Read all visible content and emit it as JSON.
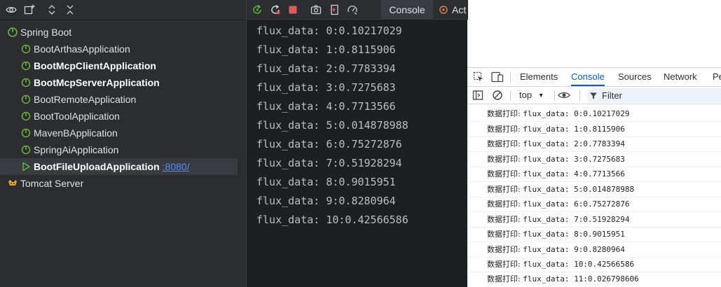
{
  "services": {
    "toolbar_icons": [
      "eye-icon",
      "add-service-icon",
      "expand-all-icon",
      "collapse-all-icon"
    ],
    "tree": [
      {
        "label": "Spring Boot",
        "type": "group",
        "icon": "spring-boot-icon"
      },
      {
        "label": "BootArthasApplication",
        "type": "app",
        "icon": "spring-app-icon",
        "bold": false
      },
      {
        "label": "BootMcpClientApplication",
        "type": "app",
        "icon": "spring-app-icon",
        "bold": true
      },
      {
        "label": "BootMcpServerApplication",
        "type": "app",
        "icon": "spring-app-icon",
        "bold": true
      },
      {
        "label": "BootRemoteApplication",
        "type": "app",
        "icon": "spring-app-icon",
        "bold": false
      },
      {
        "label": "BootToolApplication",
        "type": "app",
        "icon": "spring-app-icon",
        "bold": false
      },
      {
        "label": "MavenBApplication",
        "type": "app",
        "icon": "spring-app-icon",
        "bold": false
      },
      {
        "label": "SpringAiApplication",
        "type": "app",
        "icon": "spring-app-icon",
        "bold": false
      },
      {
        "label": "BootFileUploadApplication",
        "type": "app",
        "icon": "run-icon",
        "bold": true,
        "selected": true,
        "port": ":8080/"
      },
      {
        "label": "Tomcat Server",
        "type": "group",
        "icon": "tomcat-icon"
      }
    ]
  },
  "run_console": {
    "toolbar_icons": [
      "rerun-icon",
      "restart-icon",
      "stop-icon",
      "screenshot-icon",
      "exit-icon",
      "debug-icon"
    ],
    "tabs": [
      "Console",
      "Act"
    ],
    "active_tab": "Console",
    "lines": [
      "flux_data: 0:0.10217029",
      "flux_data: 1:0.8115906",
      "flux_data: 2:0.7783394",
      "flux_data: 3:0.7275683",
      "flux_data: 4:0.7713566",
      "flux_data: 5:0.014878988",
      "flux_data: 6:0.75272876",
      "flux_data: 7:0.51928294",
      "flux_data: 8:0.9015951",
      "flux_data: 9:0.8280964",
      "flux_data: 10:0.42566586"
    ]
  },
  "devtools": {
    "tabs": [
      "Elements",
      "Console",
      "Sources",
      "Network",
      "Pe"
    ],
    "active_tab": "Console",
    "context": "top",
    "filter_placeholder": "Filter",
    "log_prefix": "数据打印:",
    "logs": [
      "flux_data: 0:0.10217029",
      "flux_data: 1:0.8115906",
      "flux_data: 2:0.7783394",
      "flux_data: 3:0.7275683",
      "flux_data: 4:0.7713566",
      "flux_data: 5:0.014878988",
      "flux_data: 6:0.75272876",
      "flux_data: 7:0.51928294",
      "flux_data: 8:0.9015951",
      "flux_data: 9:0.8280964",
      "flux_data: 10:0.42566586",
      "flux_data: 11:0.026798606"
    ]
  }
}
